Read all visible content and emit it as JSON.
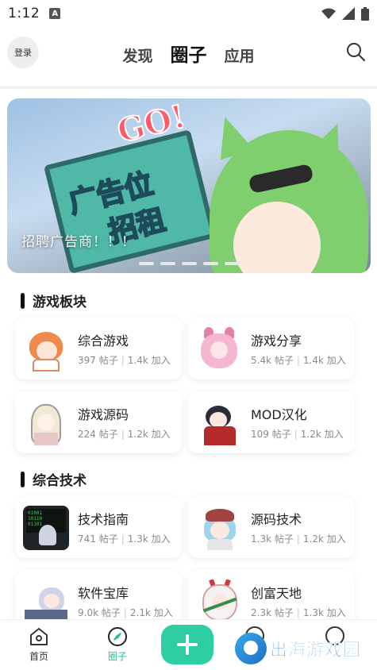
{
  "status_bar": {
    "time": "1:12",
    "app_badge": "A"
  },
  "header": {
    "login_label": "登录",
    "tabs": [
      {
        "label": "发现",
        "active": false
      },
      {
        "label": "圈子",
        "active": true
      },
      {
        "label": "应用",
        "active": false
      }
    ],
    "search_icon": "search-icon"
  },
  "banner": {
    "sign_line1": "广告位",
    "sign_line2": "招租",
    "sign_top": "GO!",
    "caption": "招聘广告商！！！",
    "page_count": 5
  },
  "sections": [
    {
      "title": "游戏板块",
      "cards": [
        {
          "title": "综合游戏",
          "posts": "397 帖子",
          "joined": "1.4k 加入"
        },
        {
          "title": "游戏分享",
          "posts": "5.4k 帖子",
          "joined": "1.4k 加入"
        },
        {
          "title": "游戏源码",
          "posts": "224 帖子",
          "joined": "1.2k 加入"
        },
        {
          "title": "MOD汉化",
          "posts": "109 帖子",
          "joined": "1.2k 加入"
        }
      ]
    },
    {
      "title": "综合技术",
      "cards": [
        {
          "title": "技术指南",
          "posts": "741 帖子",
          "joined": "1.3k 加入"
        },
        {
          "title": "源码技术",
          "posts": "1.3k 帖子",
          "joined": "1.2k 加入"
        },
        {
          "title": "软件宝库",
          "posts": "9.0k 帖子",
          "joined": "2.1k 加入"
        },
        {
          "title": "创富天地",
          "posts": "2.3k 帖子",
          "joined": "1.3k 加入"
        }
      ]
    }
  ],
  "bottom_nav": {
    "items": [
      {
        "label": "首页",
        "icon": "home-icon",
        "active": false
      },
      {
        "label": "圈子",
        "icon": "compass-icon",
        "active": true
      }
    ],
    "fab_icon": "plus-icon"
  },
  "watermark": {
    "text": "出海游戏园"
  },
  "colors": {
    "accent": "#2dcfa2",
    "active_label": "#2bbd9a",
    "meta_text": "#8a8a8a"
  }
}
